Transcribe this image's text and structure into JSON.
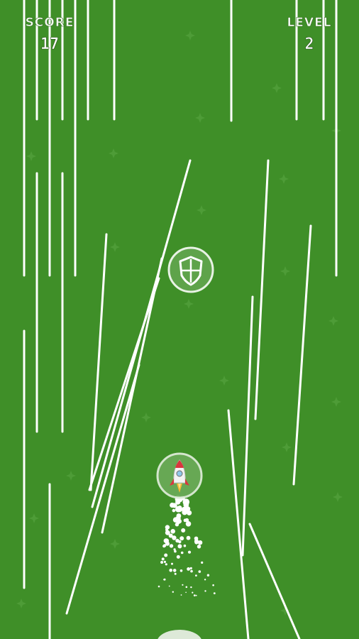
{
  "hud": {
    "score_label": "SCORE",
    "score_value": "17",
    "level_label": "LEVEL",
    "level_value": "2"
  },
  "colors": {
    "background": "#3f8f28",
    "lines": "#ffffff",
    "bubble": "#5ea34a",
    "ring": "#e8f2e4"
  },
  "icons": {
    "powerup": "shield-icon",
    "player": "rocket-icon"
  }
}
